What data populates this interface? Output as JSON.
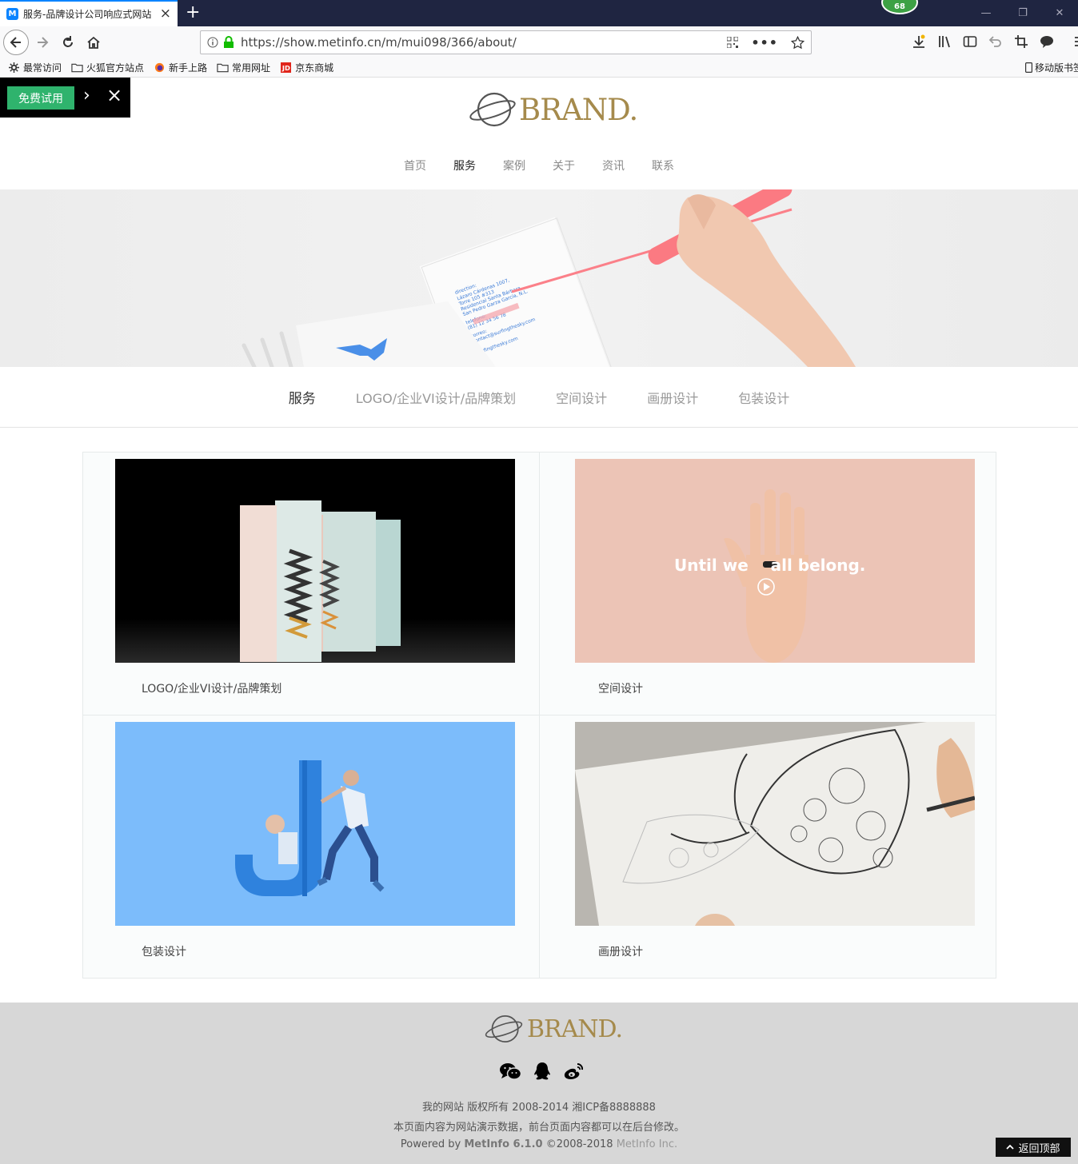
{
  "browser": {
    "tab_title": "服务-品牌设计公司响应式网站",
    "notification_count": "68",
    "url": "https://show.metinfo.cn/m/mui098/366/about/",
    "bookmarks": [
      "最常访问",
      "火狐官方站点",
      "新手上路",
      "常用网址",
      "京东商城"
    ],
    "mobile_bookmarks": "移动版书签"
  },
  "trial": {
    "button": "免费试用",
    "arrow": "›",
    "close": "×"
  },
  "brand": {
    "logo_text": "BRAND."
  },
  "main_nav": [
    "首页",
    "服务",
    "案例",
    "关于",
    "资讯",
    "联系"
  ],
  "main_nav_active": "服务",
  "sub_nav": [
    "服务",
    "LOGO/企业VI设计/品牌策划",
    "空间设计",
    "画册设计",
    "包装设计"
  ],
  "banner_card": {
    "lines": [
      "direction:",
      "Lázaro Cárdenas 1007,",
      "Torre 105 #313",
      "Residencial Santa Bárbara",
      "San Pedro Garza García, N.L.",
      "telefono:",
      "(81) 12 34 56 78",
      "correo:",
      "contact@surfingthesky.com",
      "surfingthesky.com"
    ]
  },
  "services": [
    {
      "label": "LOGO/企业VI设计/品牌策划",
      "art": "boxes"
    },
    {
      "label": "空间设计",
      "art": "hand",
      "overlay": "Until we    all belong."
    },
    {
      "label": "包装设计",
      "art": "jletter"
    },
    {
      "label": "画册设计",
      "art": "sketch"
    }
  ],
  "footer": {
    "copyright": "我的网站 版权所有 2008-2014 湘ICP备8888888",
    "notice": "本页面内容为网站演示数据，前台页面内容都可以在后台修改。",
    "powered_prefix": "Powered by",
    "powered_product": "MetInfo 6.1.0",
    "powered_years": "©2008-2018",
    "powered_company": "MetInfo Inc.",
    "social_icons": [
      "wechat-icon",
      "qq-icon",
      "weibo-icon"
    ]
  },
  "back_to_top": "返回顶部",
  "colors": {
    "brand_gold": "#a58a4c",
    "trial_green": "#2fb36d",
    "tab_blue": "#0a84ff"
  }
}
